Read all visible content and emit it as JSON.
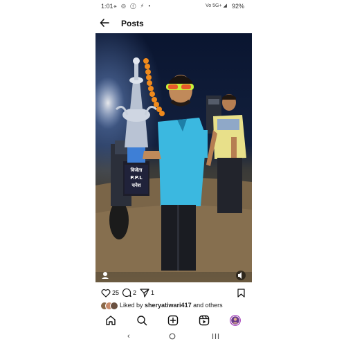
{
  "status_bar": {
    "time": "1:01",
    "left_icons": "⚹ ◎ ⓕ ⚡ •",
    "right_icons": "Vo 5G+ ◢",
    "battery": "92%"
  },
  "header": {
    "title": "Posts"
  },
  "photo": {
    "trophy_text": [
      "विजेता",
      "P.P.L",
      "चनेश"
    ]
  },
  "actions": {
    "likes_count": "25",
    "comments_count": "2",
    "shares_count": "1"
  },
  "likes": {
    "prefix": "Liked by ",
    "user": "sheryatiwari417",
    "suffix": " and others"
  },
  "icons": {
    "back": "arrow-left-icon",
    "like": "heart-icon",
    "comment": "comment-icon",
    "share": "send-icon",
    "save": "bookmark-icon",
    "home": "home-icon",
    "search": "search-icon",
    "create": "plus-square-icon",
    "reels": "reels-icon",
    "profile": "profile-avatar"
  },
  "colors": {
    "accent": "#111111",
    "jersey": "#3bb8e0",
    "marigold": "#f08a1c"
  }
}
